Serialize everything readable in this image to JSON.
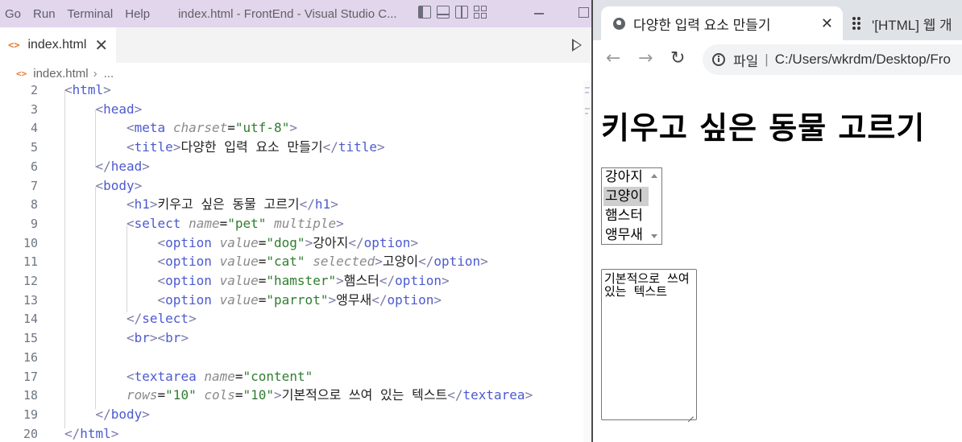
{
  "vscode": {
    "menu": [
      "Go",
      "Run",
      "Terminal",
      "Help"
    ],
    "window_title": "index.html - FrontEnd - Visual Studio C...",
    "tab": {
      "label": "index.html",
      "close": "✕"
    },
    "breadcrumb": {
      "file": "index.html",
      "more": "..."
    },
    "lines": [
      {
        "n": "2",
        "indent": 0,
        "tokens": [
          [
            "b",
            "<"
          ],
          [
            "tn",
            "html"
          ],
          [
            "b",
            ">"
          ]
        ]
      },
      {
        "n": "3",
        "indent": 1,
        "tokens": [
          [
            "b",
            "<"
          ],
          [
            "tn",
            "head"
          ],
          [
            "b",
            ">"
          ]
        ]
      },
      {
        "n": "4",
        "indent": 2,
        "tokens": [
          [
            "b",
            "<"
          ],
          [
            "tn",
            "meta"
          ],
          [
            "k",
            " "
          ],
          [
            "attr",
            "charset"
          ],
          [
            "k",
            "="
          ],
          [
            "val",
            "\"utf-8\""
          ],
          [
            "b",
            ">"
          ]
        ]
      },
      {
        "n": "5",
        "indent": 2,
        "tokens": [
          [
            "b",
            "<"
          ],
          [
            "tn",
            "title"
          ],
          [
            "b",
            ">"
          ],
          [
            "k",
            "다양한 입력 요소 만들기"
          ],
          [
            "b",
            "</"
          ],
          [
            "tn",
            "title"
          ],
          [
            "b",
            ">"
          ]
        ]
      },
      {
        "n": "6",
        "indent": 1,
        "tokens": [
          [
            "b",
            "</"
          ],
          [
            "tn",
            "head"
          ],
          [
            "b",
            ">"
          ]
        ]
      },
      {
        "n": "7",
        "indent": 1,
        "tokens": [
          [
            "b",
            "<"
          ],
          [
            "tn",
            "body"
          ],
          [
            "b",
            ">"
          ]
        ]
      },
      {
        "n": "8",
        "indent": 2,
        "tokens": [
          [
            "b",
            "<"
          ],
          [
            "tn",
            "h1"
          ],
          [
            "b",
            ">"
          ],
          [
            "k",
            "키우고 싶은 동물 고르기"
          ],
          [
            "b",
            "</"
          ],
          [
            "tn",
            "h1"
          ],
          [
            "b",
            ">"
          ]
        ]
      },
      {
        "n": "9",
        "indent": 2,
        "tokens": [
          [
            "b",
            "<"
          ],
          [
            "tn",
            "select"
          ],
          [
            "k",
            " "
          ],
          [
            "attr",
            "name"
          ],
          [
            "k",
            "="
          ],
          [
            "val",
            "\"pet\""
          ],
          [
            "k",
            " "
          ],
          [
            "attr",
            "multiple"
          ],
          [
            "b",
            ">"
          ]
        ]
      },
      {
        "n": "10",
        "indent": 3,
        "tokens": [
          [
            "b",
            "<"
          ],
          [
            "tn",
            "option"
          ],
          [
            "k",
            " "
          ],
          [
            "attr",
            "value"
          ],
          [
            "k",
            "="
          ],
          [
            "val",
            "\"dog\""
          ],
          [
            "b",
            ">"
          ],
          [
            "k",
            "강아지"
          ],
          [
            "b",
            "</"
          ],
          [
            "tn",
            "option"
          ],
          [
            "b",
            ">"
          ]
        ]
      },
      {
        "n": "11",
        "indent": 3,
        "tokens": [
          [
            "b",
            "<"
          ],
          [
            "tn",
            "option"
          ],
          [
            "k",
            " "
          ],
          [
            "attr",
            "value"
          ],
          [
            "k",
            "="
          ],
          [
            "val",
            "\"cat\""
          ],
          [
            "k",
            " "
          ],
          [
            "attr",
            "selected"
          ],
          [
            "b",
            ">"
          ],
          [
            "k",
            "고양이"
          ],
          [
            "b",
            "</"
          ],
          [
            "tn",
            "option"
          ],
          [
            "b",
            ">"
          ]
        ]
      },
      {
        "n": "12",
        "indent": 3,
        "tokens": [
          [
            "b",
            "<"
          ],
          [
            "tn",
            "option"
          ],
          [
            "k",
            " "
          ],
          [
            "attr",
            "value"
          ],
          [
            "k",
            "="
          ],
          [
            "val",
            "\"hamster\""
          ],
          [
            "b",
            ">"
          ],
          [
            "k",
            "햄스터"
          ],
          [
            "b",
            "</"
          ],
          [
            "tn",
            "option"
          ],
          [
            "b",
            ">"
          ]
        ]
      },
      {
        "n": "13",
        "indent": 3,
        "tokens": [
          [
            "b",
            "<"
          ],
          [
            "tn",
            "option"
          ],
          [
            "k",
            " "
          ],
          [
            "attr",
            "value"
          ],
          [
            "k",
            "="
          ],
          [
            "val",
            "\"parrot\""
          ],
          [
            "b",
            ">"
          ],
          [
            "k",
            "앵무새"
          ],
          [
            "b",
            "</"
          ],
          [
            "tn",
            "option"
          ],
          [
            "b",
            ">"
          ]
        ]
      },
      {
        "n": "14",
        "indent": 2,
        "tokens": [
          [
            "b",
            "</"
          ],
          [
            "tn",
            "select"
          ],
          [
            "b",
            ">"
          ]
        ]
      },
      {
        "n": "15",
        "indent": 2,
        "tokens": [
          [
            "b",
            "<"
          ],
          [
            "tn",
            "br"
          ],
          [
            "b",
            "><"
          ],
          [
            "tn",
            "br"
          ],
          [
            "b",
            ">"
          ]
        ]
      },
      {
        "n": "16",
        "indent": 0,
        "tokens": []
      },
      {
        "n": "17",
        "indent": 2,
        "tokens": [
          [
            "b",
            "<"
          ],
          [
            "tn",
            "textarea"
          ],
          [
            "k",
            " "
          ],
          [
            "attr",
            "name"
          ],
          [
            "k",
            "="
          ],
          [
            "val",
            "\"content\""
          ]
        ]
      },
      {
        "n": "18",
        "indent": 2,
        "tokens": [
          [
            "attr",
            "rows"
          ],
          [
            "k",
            "="
          ],
          [
            "val",
            "\"10\""
          ],
          [
            "k",
            " "
          ],
          [
            "attr",
            "cols"
          ],
          [
            "k",
            "="
          ],
          [
            "val",
            "\"10\""
          ],
          [
            "b",
            ">"
          ],
          [
            "k",
            "기본적으로 쓰여 있는 텍스트"
          ],
          [
            "b",
            "</"
          ],
          [
            "tn",
            "textarea"
          ],
          [
            "b",
            ">"
          ]
        ]
      },
      {
        "n": "19",
        "indent": 1,
        "tokens": [
          [
            "b",
            "</"
          ],
          [
            "tn",
            "body"
          ],
          [
            "b",
            ">"
          ]
        ]
      },
      {
        "n": "20",
        "indent": 0,
        "tokens": [
          [
            "b",
            "</"
          ],
          [
            "tn",
            "html"
          ],
          [
            "b",
            ">"
          ]
        ]
      }
    ]
  },
  "browser": {
    "active_tab": {
      "title": "다양한 입력 요소 만들기",
      "close": "✕"
    },
    "inactive_tab": {
      "title": "'[HTML] 웹 개"
    },
    "address": {
      "label": "파일",
      "url": "C:/Users/wkrdm/Desktop/Fro"
    },
    "page": {
      "heading": "키우고 싶은 동물 고르기",
      "select_options": [
        {
          "label": "강아지",
          "selected": false
        },
        {
          "label": "고양이",
          "selected": true
        },
        {
          "label": "햄스터",
          "selected": false
        },
        {
          "label": "앵무새",
          "selected": false
        }
      ],
      "textarea_text": "기본적으로 쓰여 있는 텍스트"
    }
  }
}
